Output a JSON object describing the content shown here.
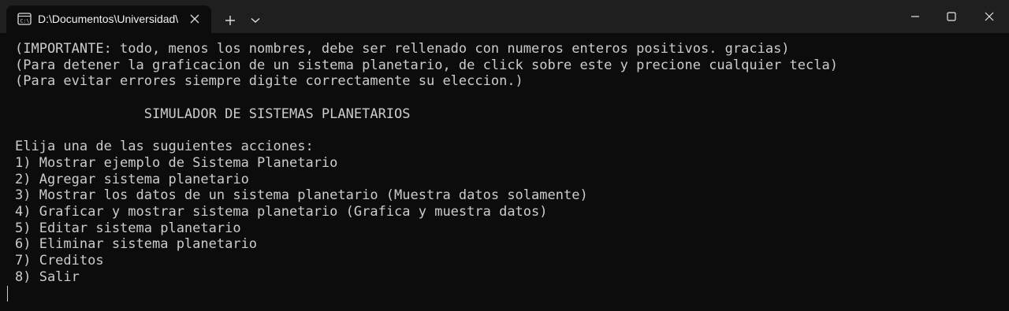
{
  "window": {
    "tab_title": "D:\\Documentos\\Universidad\\U"
  },
  "icons": {
    "tab_icon": "terminal-icon",
    "tab_close": "close-icon",
    "new_tab": "plus-icon",
    "dropdown": "chevron-down-icon",
    "minimize": "minimize-icon",
    "maximize": "maximize-icon",
    "close": "close-icon"
  },
  "colors": {
    "background": "#0c0c0c",
    "titlebar": "#1f1f1f",
    "text": "#cccccc"
  },
  "console": {
    "lines": [
      "(IMPORTANTE: todo, menos los nombres, debe ser rellenado con numeros enteros positivos. gracias)",
      "(Para detener la graficacion de un sistema planetario, de click sobre este y precione cualquier tecla)",
      "(Para evitar errores siempre digite correctamente su eleccion.)",
      "",
      "                SIMULADOR DE SISTEMAS PLANETARIOS",
      "",
      "Elija una de las suguientes acciones:",
      "1) Mostrar ejemplo de Sistema Planetario",
      "2) Agregar sistema planetario",
      "3) Mostrar los datos de un sistema planetario (Muestra datos solamente)",
      "4) Graficar y mostrar sistema planetario (Grafica y muestra datos)",
      "5) Editar sistema planetario",
      "6) Eliminar sistema planetario",
      "7) Creditos",
      "8) Salir"
    ]
  }
}
